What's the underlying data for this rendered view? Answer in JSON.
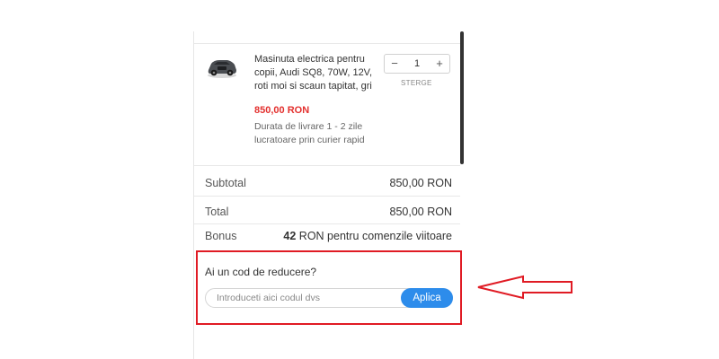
{
  "product": {
    "name": "Masinuta electrica pentru copii, Audi SQ8, 70W, 12V, roti moi si scaun tapitat, gri",
    "price": "850,00 RON",
    "delivery": "Durata de livrare 1 - 2 zile lucratoare prin curier rapid",
    "quantity": "1",
    "decrease_label": "−",
    "increase_label": "+",
    "remove_label": "STERGE"
  },
  "summary": {
    "subtotal_label": "Subtotal",
    "subtotal_value": "850,00 RON",
    "total_label": "Total",
    "total_value": "850,00 RON",
    "bonus_label": "Bonus",
    "bonus_amount": "42",
    "bonus_text": " RON pentru comenzile viitoare"
  },
  "coupon": {
    "title": "Ai un cod de reducere?",
    "placeholder": "Introduceti aici codul dvs",
    "apply_label": "Aplica"
  },
  "colors": {
    "price": "#e3302e",
    "button": "#2d8ceb",
    "highlight": "#e01b24"
  }
}
